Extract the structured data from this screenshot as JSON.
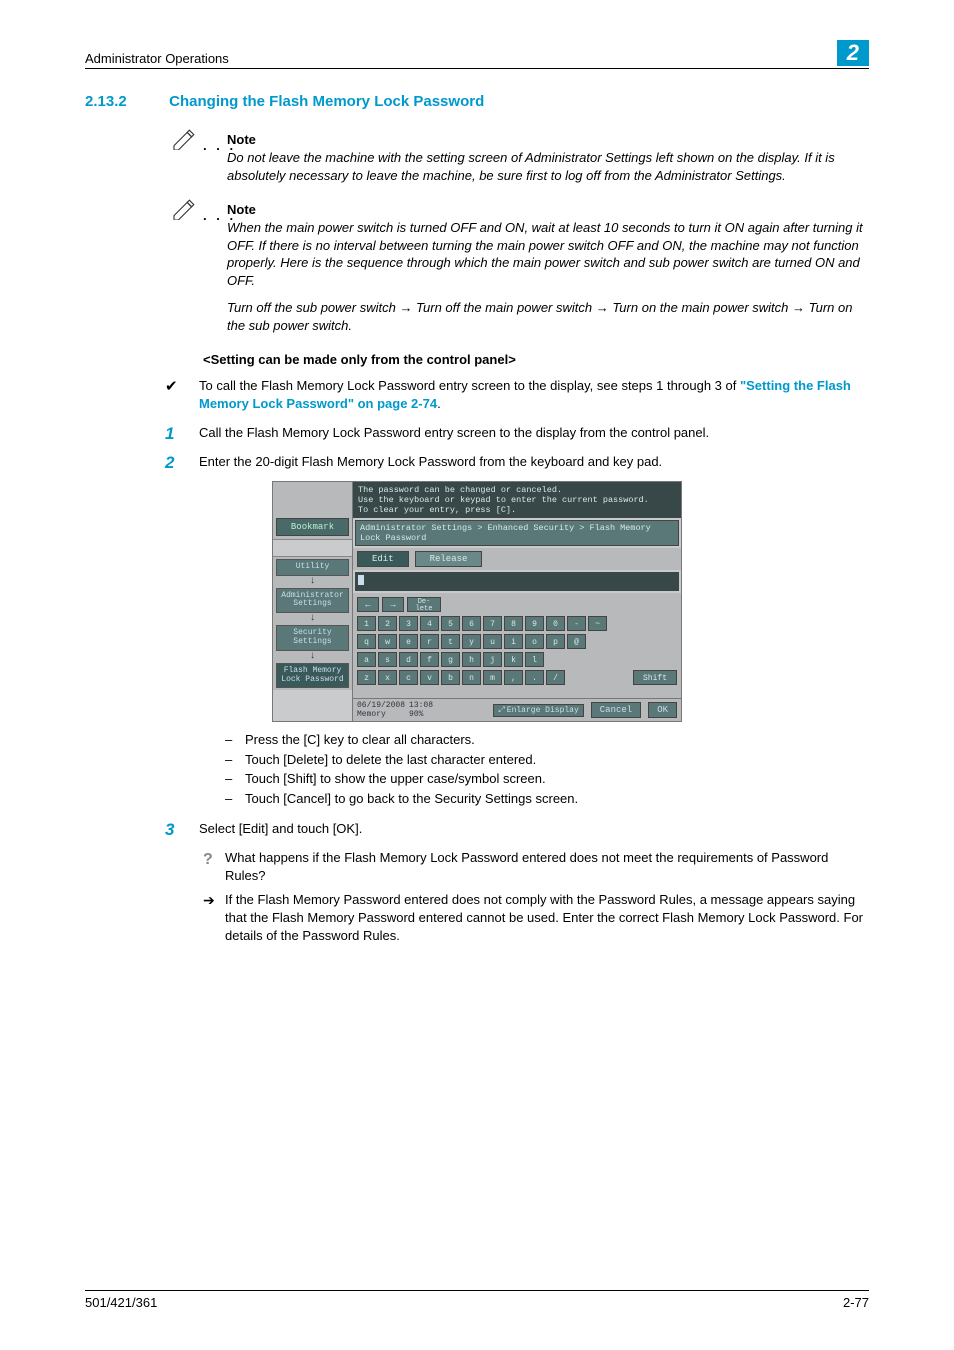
{
  "header": {
    "title": "Administrator Operations",
    "chapter": "2"
  },
  "section": {
    "number": "2.13.2",
    "title": "Changing the Flash Memory Lock Password"
  },
  "notes": [
    {
      "label": "Note",
      "body": "Do not leave the machine with the setting screen of Administrator Settings left shown on the display. If it is absolutely necessary to leave the machine, be sure first to log off from the Administrator Settings."
    },
    {
      "label": "Note",
      "body": "When the main power switch is turned OFF and ON, wait at least 10 seconds to turn it ON again after turning it OFF. If there is no interval between turning the main power switch OFF and ON, the machine may not function properly. Here is the sequence through which the main power switch and sub power switch are turned ON and OFF.",
      "body2": "Turn off the sub power switch → Turn off the main power switch → Turn on the main power switch → Turn on the sub power switch."
    }
  ],
  "subhead": "<Setting can be made only from the control panel>",
  "checkline": {
    "pre": "To call the Flash Memory Lock Password entry screen to the display, see steps 1 through 3 of ",
    "link": "\"Setting the Flash Memory Lock Password\" on page 2-74",
    "post": "."
  },
  "steps": [
    "Call the Flash Memory Lock Password entry screen to the display from the control panel.",
    "Enter the 20-digit Flash Memory Lock Password from the keyboard and key pad.",
    "Select [Edit] and touch [OK]."
  ],
  "bullets": [
    "Press the [C] key to clear all characters.",
    "Touch [Delete] to delete the last character entered.",
    "Touch [Shift] to show the upper case/symbol screen.",
    "Touch [Cancel] to go back to the Security Settings screen."
  ],
  "qa": {
    "q": "What happens if the Flash Memory Lock Password entered does not meet the requirements of Password Rules?",
    "a": "If the Flash Memory Password entered does not comply with the Password Rules, a message appears saying that the Flash Memory Password entered cannot be used. Enter the correct Flash Memory Lock Password. For details of the Password Rules."
  },
  "footer": {
    "left": "501/421/361",
    "right": "2-77"
  },
  "device": {
    "msg1": "The password can be changed or canceled.",
    "msg2": "Use the keyboard or keypad to enter the current password.",
    "msg3": "To clear your entry, press [C].",
    "bookmark": "Bookmark",
    "crumb": "Administrator Settings > Enhanced Security > Flash Memory Lock Password",
    "sidebar": [
      "Utility",
      "Administrator Settings",
      "Security Settings",
      "Flash Memory Lock Password"
    ],
    "tabs": {
      "edit": "Edit",
      "release": "Release"
    },
    "del": "De-\nlete",
    "shift": "Shift",
    "row1": [
      "1",
      "2",
      "3",
      "4",
      "5",
      "6",
      "7",
      "8",
      "9",
      "0",
      "-",
      "~"
    ],
    "row2": [
      "q",
      "w",
      "e",
      "r",
      "t",
      "y",
      "u",
      "i",
      "o",
      "p",
      "@"
    ],
    "row3": [
      "a",
      "s",
      "d",
      "f",
      "g",
      "h",
      "j",
      "k",
      "l"
    ],
    "row4": [
      "z",
      "x",
      "c",
      "v",
      "b",
      "n",
      "m",
      ",",
      ".",
      "/"
    ],
    "footer": {
      "date": "06/19/2008",
      "time": "13:08",
      "mem_label": "Memory",
      "mem": "90%",
      "enlarge": "Enlarge Display",
      "cancel": "Cancel",
      "ok": "OK"
    }
  }
}
